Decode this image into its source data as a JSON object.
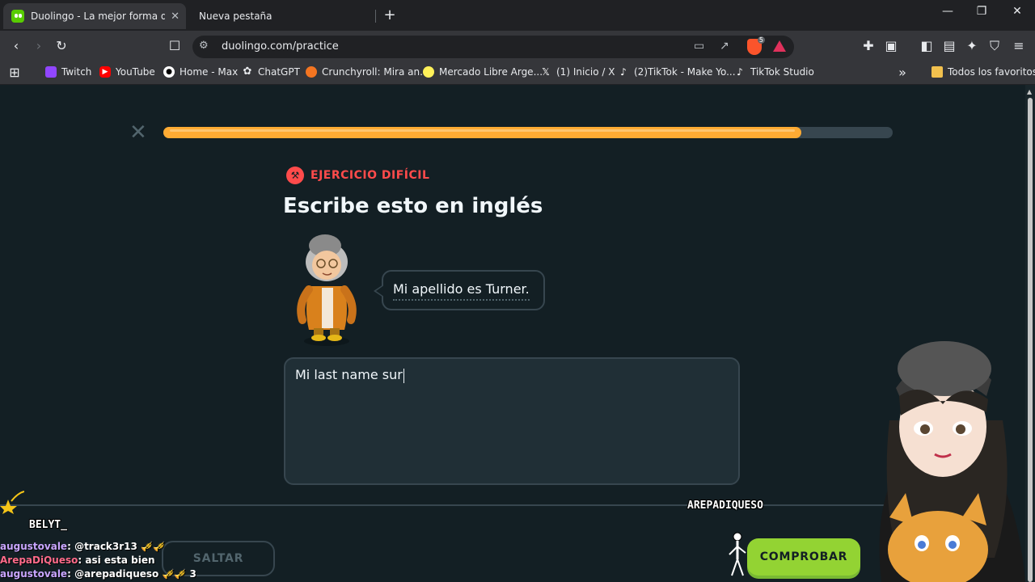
{
  "browser": {
    "tabs": [
      {
        "title": "Duolingo - La mejor forma de ap",
        "active": true
      },
      {
        "title": "Nueva pestaña",
        "active": false
      }
    ],
    "new_tab_icon": "+",
    "url": "duolingo.com/practice",
    "brave_badge": "5",
    "bookmarks": [
      {
        "label": "Twitch",
        "icon": "twitch-icon",
        "color": "#9146ff"
      },
      {
        "label": "YouTube",
        "icon": "youtube-icon",
        "color": "#ff0000"
      },
      {
        "label": "Home - Max",
        "icon": "max-icon",
        "color": "#ffffff"
      },
      {
        "label": "ChatGPT",
        "icon": "chatgpt-icon",
        "color": "#e8eaed"
      },
      {
        "label": "Crunchyroll: Mira an...",
        "icon": "crunchyroll-icon",
        "color": "#f47521"
      },
      {
        "label": "Mercado Libre Arge...",
        "icon": "mercadolibre-icon",
        "color": "#fff159"
      },
      {
        "label": "(1) Inicio / X",
        "icon": "x-icon",
        "color": "#ffffff"
      },
      {
        "label": "(2)TikTok - Make Yo...",
        "icon": "tiktok-icon",
        "color": "#ffffff"
      },
      {
        "label": "TikTok Studio",
        "icon": "tiktok-icon",
        "color": "#ffffff"
      }
    ],
    "all_bookmarks_label": "Todos los favoritos"
  },
  "lesson": {
    "progress": 0.875,
    "progress_color": "#ffab33",
    "badge_label": "EJERCICIO DIFÍCIL",
    "badge_color": "#ff4b4b",
    "prompt": "Escribe esto en inglés",
    "sentence": "Mi apellido es Turner.",
    "answer_text": "Mi last name sur",
    "skip_label": "SALTAR",
    "check_label": "COMPROBAR",
    "check_color": "#93d333"
  },
  "stream_overlay": {
    "name_left": "BELYT_",
    "name_right": "AREPADIQUESO",
    "chat": [
      {
        "user": "augustovale",
        "message": "@track3r13 🎺🎺"
      },
      {
        "user": "ArepaDiQueso",
        "message": "asi esta bien"
      },
      {
        "user": "augustovale",
        "message": "@arepadiqueso 🎺🎺 3"
      }
    ]
  }
}
